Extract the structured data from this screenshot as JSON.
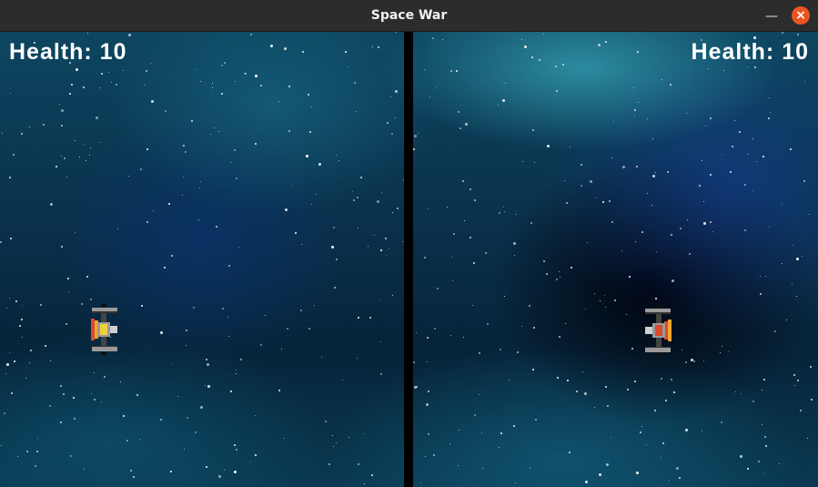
{
  "window": {
    "title": "Space War",
    "minimize_icon": "minimize-icon",
    "close_icon": "close-icon"
  },
  "players": [
    {
      "health_text": "Health: 10",
      "ship_icon": "yellow-spaceship-icon"
    },
    {
      "health_text": "Health: 10",
      "ship_icon": "red-spaceship-icon"
    }
  ],
  "colors": {
    "close_button": "#e95420",
    "titlebar": "#2c2c2c",
    "divider": "#000000",
    "yellow_ship": "#f2d03a",
    "red_ship": "#d94b2b"
  }
}
